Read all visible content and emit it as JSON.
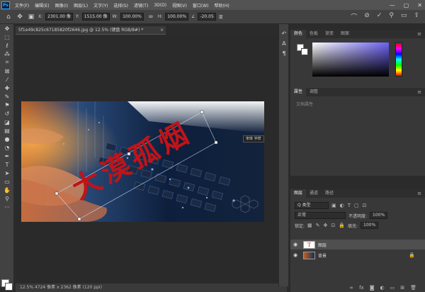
{
  "menubar": {
    "app_icon": "Ps",
    "items": [
      "文件(F)",
      "编辑(E)",
      "图像(I)",
      "图层(L)",
      "文字(Y)",
      "选择(S)",
      "滤镜(T)",
      "3D(D)",
      "视图(V)",
      "窗口(W)",
      "帮助(H)"
    ],
    "window_controls": [
      "—",
      "▢",
      "✕"
    ]
  },
  "options": {
    "x_label": "X:",
    "x_value": "2301.00 像",
    "y_label": "Y:",
    "y_value": "1515.00 像",
    "w_label": "W:",
    "w_value": "100.00%",
    "h_label": "H:",
    "h_value": "100.00%",
    "angle_label": "∠",
    "angle_value": "-20.05",
    "skew_label": "度"
  },
  "document": {
    "tab_title": "5f1e49c825c67185820f2646.jpg @ 12.5% (键盘 RGB/8#) *",
    "status": "12.5%  4724 像素 x 2362 像素 (120 ppi)",
    "overlay_text": "大漠孤烟",
    "badge": "宋体 字样"
  },
  "color_panel": {
    "tabs": [
      "颜色",
      "色板",
      "渐变",
      "图案"
    ],
    "fg_color": "#ffffff",
    "bg_color": "#ffffff",
    "hue": "#6d62f5"
  },
  "properties_panel": {
    "tabs": [
      "属性",
      "调整"
    ],
    "body": "文档属性"
  },
  "layers_panel": {
    "tabs": [
      "图层",
      "通道",
      "路径"
    ],
    "filter_label": "Q 类型",
    "blend_mode": "正常",
    "opacity_label": "不透明度:",
    "opacity_value": "100%",
    "lock_label": "锁定:",
    "fill_label": "填充:",
    "fill_value": "100%",
    "layers": [
      {
        "name": "图层",
        "selected": true
      },
      {
        "name": "背景",
        "selected": false
      }
    ]
  }
}
